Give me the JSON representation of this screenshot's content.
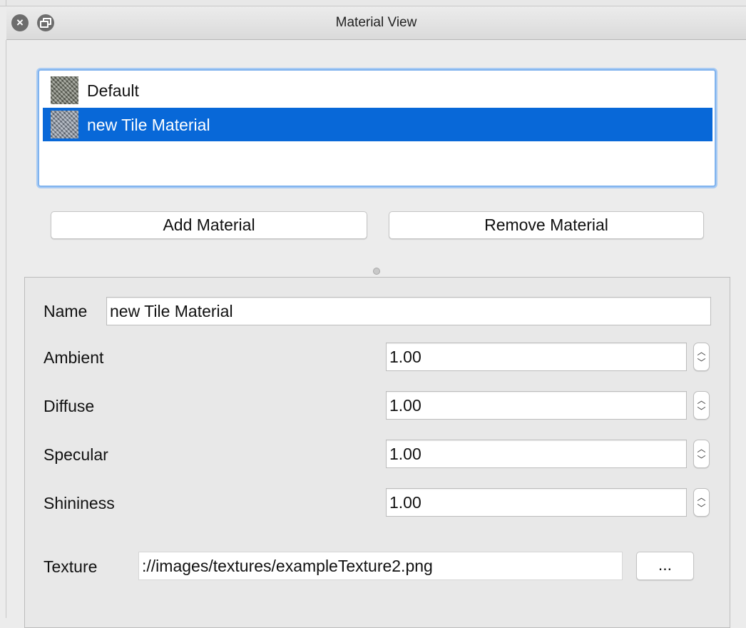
{
  "window": {
    "title": "Material View"
  },
  "materials": {
    "items": [
      {
        "label": "Default"
      },
      {
        "label": "new Tile Material"
      }
    ],
    "selected": "new Tile Material"
  },
  "buttons": {
    "add_label": "Add Material",
    "remove_label": "Remove Material",
    "browse_label": "..."
  },
  "properties": {
    "name_label": "Name",
    "name_value": "new Tile Material",
    "ambient_label": "Ambient",
    "ambient_value": "1.00",
    "diffuse_label": "Diffuse",
    "diffuse_value": "1.00",
    "specular_label": "Specular",
    "specular_value": "1.00",
    "shininess_label": "Shininess",
    "shininess_value": "1.00",
    "texture_label": "Texture",
    "texture_value": "://images/textures/exampleTexture2.png"
  },
  "icons": {
    "close": "close-icon",
    "float": "float-icon",
    "spin_up": "chevron-up-icon",
    "spin_down": "chevron-down-icon"
  },
  "colors": {
    "selection": "#0868d8",
    "focus_ring": "#80b3ee"
  }
}
